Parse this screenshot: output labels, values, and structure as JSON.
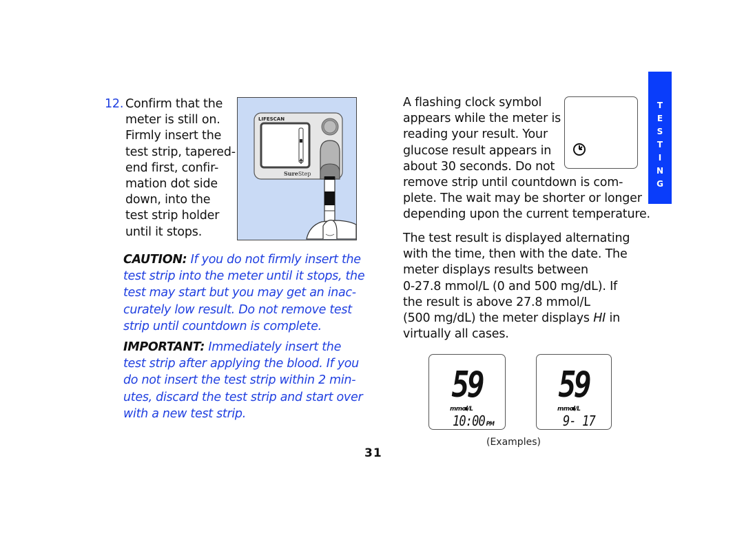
{
  "step": {
    "number": "12.",
    "lines": [
      "Confirm that the",
      "meter is still on.",
      "Firmly insert the",
      "test strip, tapered-",
      "end first, confir-",
      "mation dot side",
      "down, into the",
      "test strip holder",
      "until it stops."
    ]
  },
  "illustration": {
    "brand_label": "LIFESCAN",
    "model_label_bold": "Sure",
    "model_label_rest": "Step",
    "background_color": "#c9daf5"
  },
  "caution": {
    "label": "CAUTION:",
    "lines": [
      " If you do not firmly insert the",
      "test strip into the meter until it stops, the",
      "test may start but you may get an inac-",
      "curately low result. Do not remove test",
      "strip until countdown is complete."
    ]
  },
  "important": {
    "label": "IMPORTANT:",
    "lines": [
      " Immediately insert the",
      "test strip after applying the blood. If you",
      "do not insert the test strip within 2 min-",
      "utes, discard the test strip and start over",
      "with a new test strip."
    ]
  },
  "right": {
    "para1": [
      "A flashing clock symbol",
      "appears while the meter is",
      "reading your result. Your",
      "glucose result appears in",
      "about 30 seconds. Do not",
      "remove strip until countdown is com-",
      "plete. The wait may be shorter or longer",
      "depending upon the current temperature."
    ],
    "para2": [
      "The test result is displayed alternating",
      "with the time, then with the date. The",
      "meter displays results between",
      "0-27.8 mmol/L (0 and 500 mg/dL). If",
      "the result is above 27.8 mmol/L"
    ],
    "para2_line6_before": "(500 mg/dL) the meter displays ",
    "para2_line6_hi": "HI",
    "para2_line6_after": " in",
    "para2_line7": "virtually all cases."
  },
  "examples": {
    "caption": "(Examples)",
    "display1": {
      "value": "59",
      "unit": "mmol/L",
      "sub": "10:00",
      "suffix": "PM"
    },
    "display2": {
      "value": "59",
      "unit": "mmol/L",
      "sub": "9- 17",
      "suffix": ""
    }
  },
  "page_number": "31",
  "side_tab": {
    "letters": [
      "T",
      "E",
      "S",
      "T",
      "I",
      "N",
      "G"
    ],
    "color": "#0a3dfa"
  },
  "accent_color": "#1f3fe0"
}
